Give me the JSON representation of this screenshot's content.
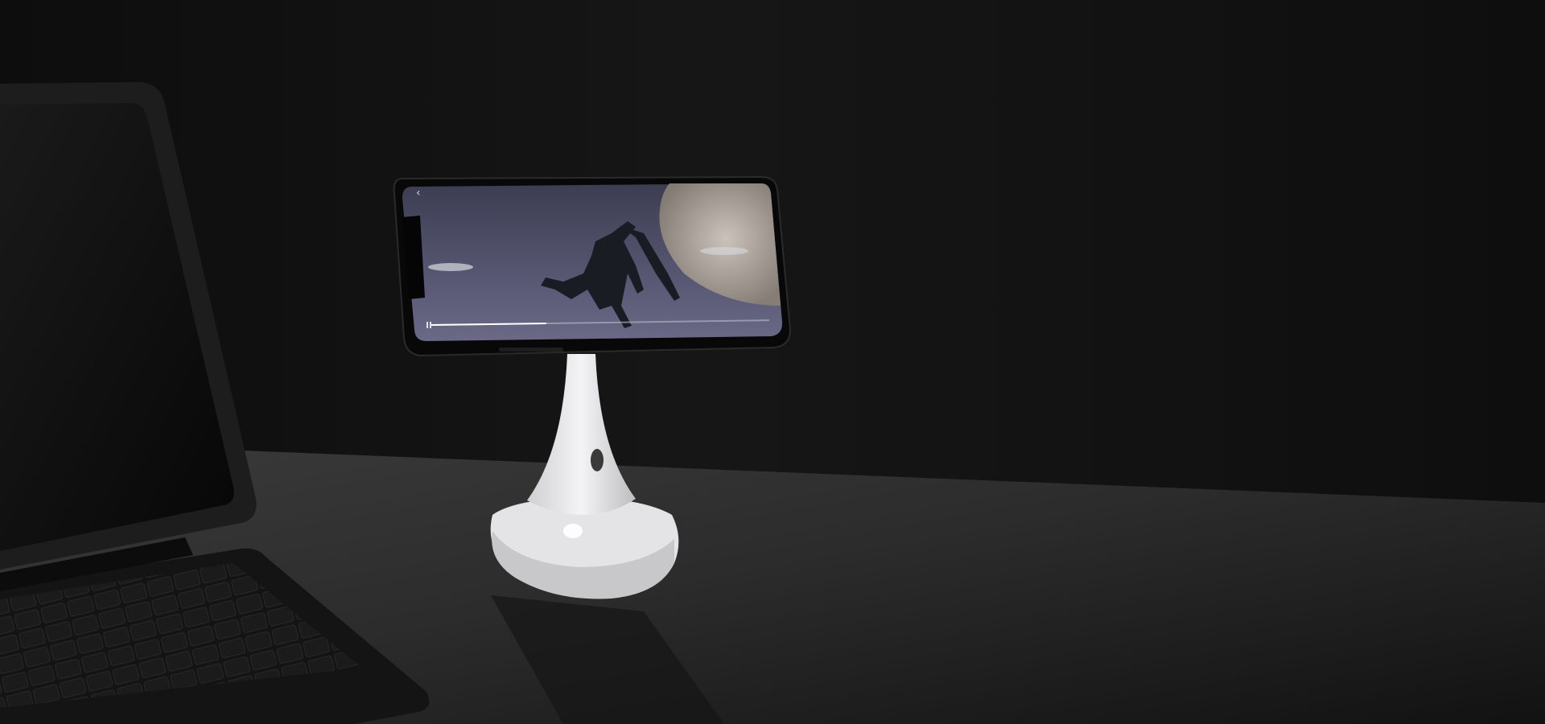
{
  "scene": {
    "subject": "phone-stand-product-hero",
    "colors": {
      "background": "#131313",
      "desk": "#2b2b2b",
      "stand": "#e8e8ea",
      "phone_frame": "#0a0a0a",
      "screen_sky": "#5a5a78"
    },
    "video_progress": 0.34
  }
}
